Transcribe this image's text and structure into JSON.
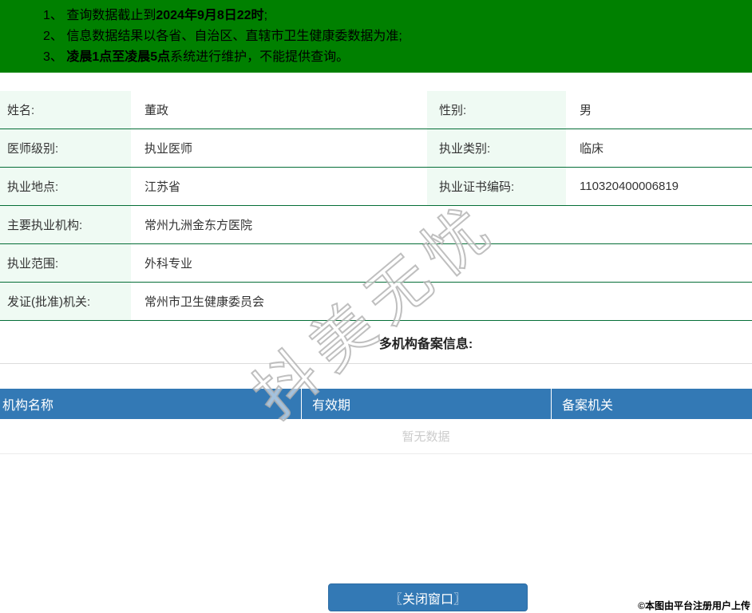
{
  "colors": {
    "banner_green": "#008000",
    "row_border_green": "#056e37",
    "label_cell_mint": "#effaf3",
    "header_blue": "#3379b5",
    "empty_text_gray": "#cccccc"
  },
  "notice": {
    "lines": [
      {
        "pre": "1、 查询数据截止到",
        "bold": "2024年9月8日22时",
        "post": ";"
      },
      {
        "pre": "2、 信息数据结果以各省、自治区、直辖市卫生健康委数据为准;",
        "bold": "",
        "post": ""
      },
      {
        "pre": "3、 ",
        "bold": "凌晨1点至凌晨5点",
        "post": "系统进行维护，不能提供查询。"
      }
    ]
  },
  "info": {
    "rows": [
      {
        "label1": "姓名:",
        "value1": "董政",
        "label2": "性别:",
        "value2": "男"
      },
      {
        "label1": "医师级别:",
        "value1": "执业医师",
        "label2": "执业类别:",
        "value2": "临床"
      },
      {
        "label1": "执业地点:",
        "value1": "江苏省",
        "label2": "执业证书编码:",
        "value2": "110320400006819"
      },
      {
        "label1": "主要执业机构:",
        "value1": "常州九洲金东方医院"
      },
      {
        "label1": "执业范围:",
        "value1": "外科专业"
      },
      {
        "label1": "发证(批准)机关:",
        "value1": "常州市卫生健康委员会"
      }
    ]
  },
  "registration": {
    "title": "多机构备案信息:",
    "columns": [
      "机构名称",
      "有效期",
      "备案机关"
    ],
    "empty_text": "暂无数据"
  },
  "close_button_label": "〖关闭窗口〗",
  "watermark_text": "抖美无忧",
  "copyright_text": "©本图由平台注册用户上传"
}
